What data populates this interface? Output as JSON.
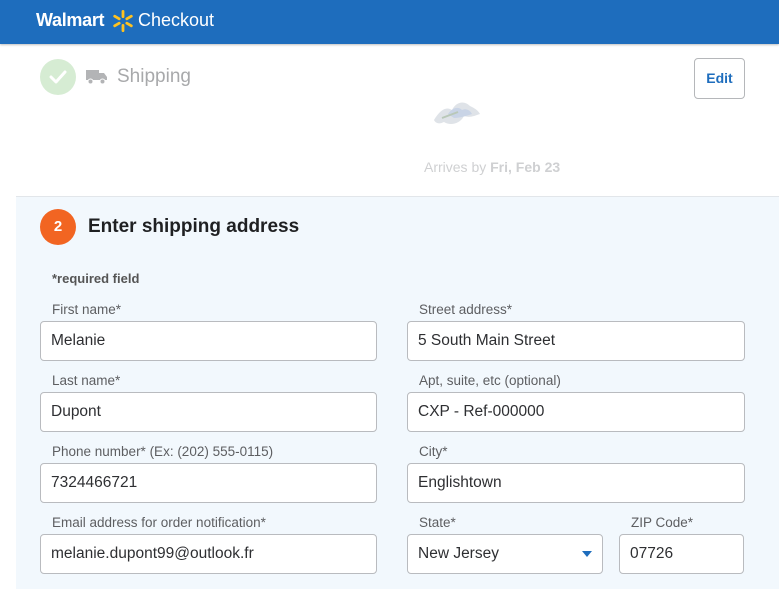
{
  "header": {
    "brand": "Walmart",
    "title": "Checkout",
    "spark_color": "#ffc220",
    "bar_color": "#1e6dbd"
  },
  "shipping_summary": {
    "title": "Shipping",
    "edit_label": "Edit",
    "arrives_prefix": "Arrives by",
    "arrives_date": "Fri, Feb 23"
  },
  "address_form": {
    "step_number": "2",
    "title": "Enter shipping address",
    "required_note": "*required field",
    "fields": {
      "first_name": {
        "label": "First name*",
        "value": "Melanie"
      },
      "last_name": {
        "label": "Last name*",
        "value": "Dupont"
      },
      "phone": {
        "label": "Phone number*  (Ex: (202) 555-0115)",
        "value": "7324466721"
      },
      "email": {
        "label": "Email address for order notification*",
        "value": "melanie.dupont99@outlook.fr"
      },
      "street": {
        "label": "Street address*",
        "value": "5 South Main Street"
      },
      "apt": {
        "label": "Apt, suite, etc (optional)",
        "value": "CXP - Ref-000000"
      },
      "city": {
        "label": "City*",
        "value": "Englishtown"
      },
      "state": {
        "label": "State*",
        "value": "New Jersey"
      },
      "zip": {
        "label": "ZIP Code*",
        "value": "07726"
      }
    }
  },
  "icons": {
    "spark": "walmart-spark-icon",
    "check": "check-icon",
    "truck": "truck-icon",
    "caret": "chevron-down-icon"
  }
}
